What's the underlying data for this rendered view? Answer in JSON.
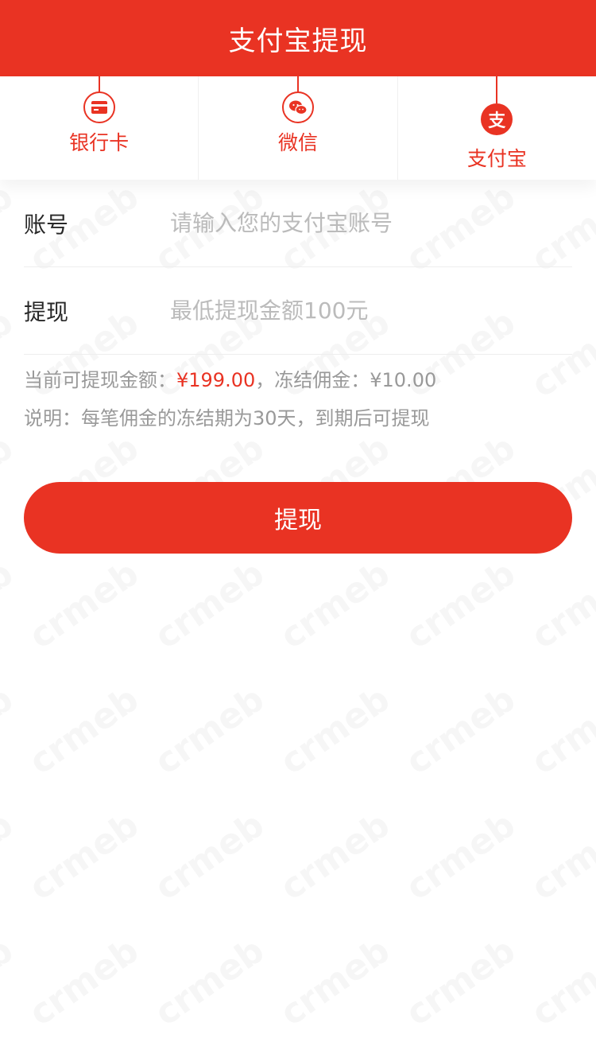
{
  "header": {
    "title": "支付宝提现"
  },
  "tabs": [
    {
      "label": "银行卡",
      "icon": "bank-card-icon",
      "active": false
    },
    {
      "label": "微信",
      "icon": "wechat-icon",
      "active": false
    },
    {
      "label": "支付宝",
      "icon": "alipay-icon",
      "active": true,
      "glyph": "支"
    }
  ],
  "form": {
    "account": {
      "label": "账号",
      "placeholder": "请输入您的支付宝账号",
      "value": ""
    },
    "amount": {
      "label": "提现",
      "placeholder": "最低提现金额100元",
      "value": ""
    }
  },
  "info": {
    "available_label": "当前可提现金额：",
    "available_value": "¥199.00",
    "frozen_label": "，冻结佣金：",
    "frozen_value": "¥10.00",
    "note": "说明：每笔佣金的冻结期为30天，到期后可提现"
  },
  "submit": {
    "label": "提现"
  },
  "watermark": {
    "text": "crmeb"
  },
  "colors": {
    "accent": "#e93323",
    "text": "#282828",
    "muted": "#999999",
    "placeholder": "#bbbbbb"
  }
}
